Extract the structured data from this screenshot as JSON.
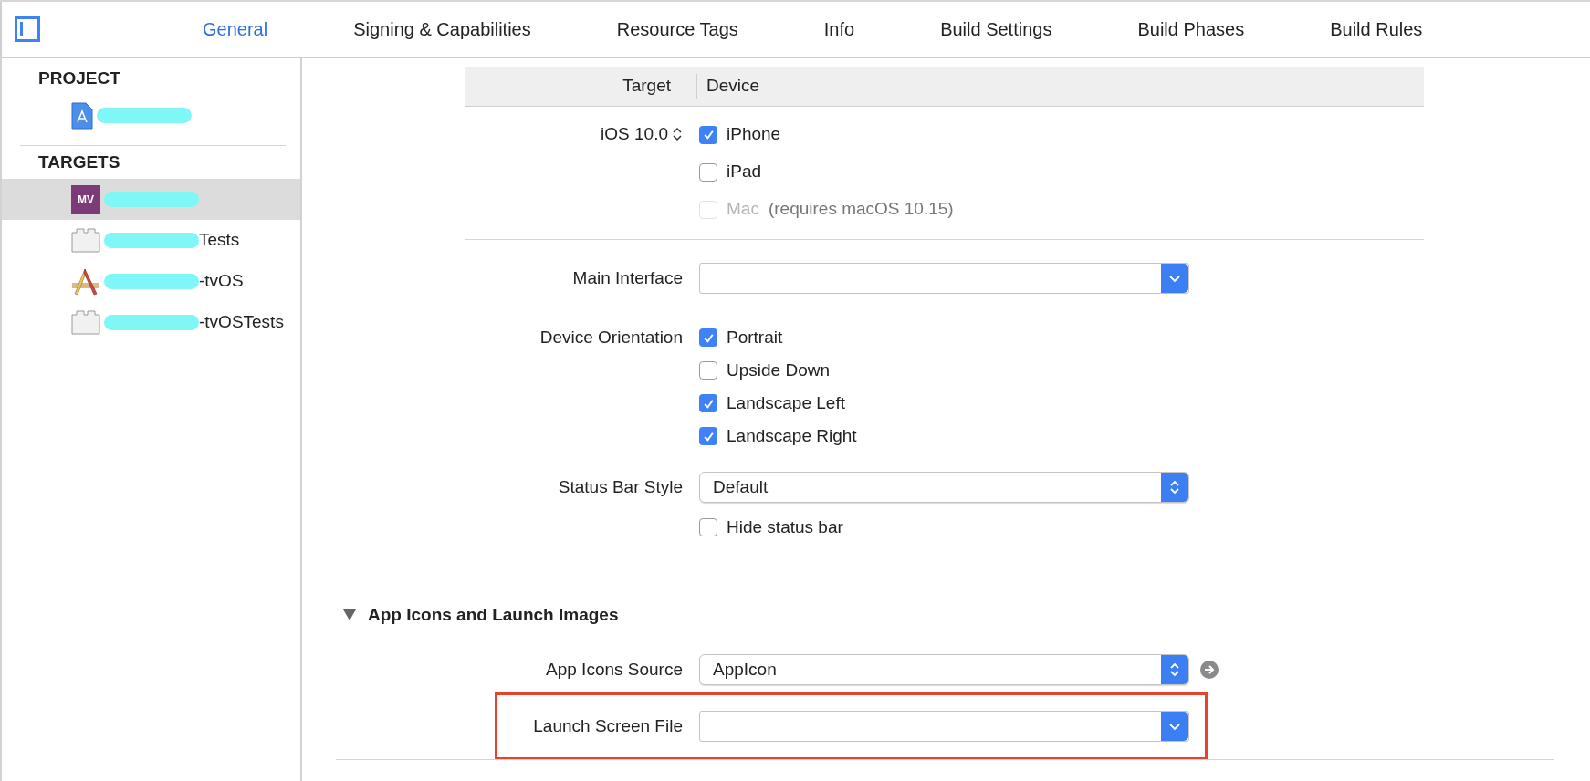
{
  "tabs": [
    {
      "label": "General",
      "selected": true
    },
    {
      "label": "Signing & Capabilities",
      "selected": false
    },
    {
      "label": "Resource Tags",
      "selected": false
    },
    {
      "label": "Info",
      "selected": false
    },
    {
      "label": "Build Settings",
      "selected": false
    },
    {
      "label": "Build Phases",
      "selected": false
    },
    {
      "label": "Build Rules",
      "selected": false
    }
  ],
  "sidebar": {
    "sections": [
      {
        "title": "PROJECT",
        "items": [
          {
            "kind": "project",
            "redacted": true,
            "selected": false
          }
        ]
      },
      {
        "title": "TARGETS",
        "items": [
          {
            "kind": "app",
            "badge": "MV",
            "redacted": true,
            "selected": true
          },
          {
            "kind": "test",
            "label": "Tests",
            "redacted": true,
            "selected": false
          },
          {
            "kind": "tvapp",
            "label": "-tvOS",
            "redacted": true,
            "selected": false
          },
          {
            "kind": "test",
            "label": "-tvOSTests",
            "redacted": true,
            "selected": false
          }
        ]
      }
    ]
  },
  "deployment": {
    "header": {
      "target": "Target",
      "device": "Device"
    },
    "target_version": "iOS 10.0",
    "devices": [
      {
        "label": "iPhone",
        "checked": true,
        "disabled": false
      },
      {
        "label": "iPad",
        "checked": false,
        "disabled": false
      },
      {
        "label": "Mac",
        "checked": false,
        "disabled": true,
        "note": "(requires macOS 10.15)"
      }
    ]
  },
  "main_interface": {
    "label": "Main Interface",
    "kind": "pulldown"
  },
  "orientation": {
    "label": "Device Orientation",
    "options": [
      {
        "label": "Portrait",
        "checked": true
      },
      {
        "label": "Upside Down",
        "checked": false
      },
      {
        "label": "Landscape Left",
        "checked": true
      },
      {
        "label": "Landscape Right",
        "checked": true
      }
    ]
  },
  "status_bar": {
    "label": "Status Bar Style",
    "kind": "popup",
    "value": "Default",
    "hide": {
      "label": "Hide status bar",
      "checked": false
    }
  },
  "app_icons": {
    "title": "App Icons and Launch Images",
    "expanded": true,
    "source": {
      "label": "App Icons Source",
      "kind": "popup",
      "value": "AppIcon"
    },
    "launch_screen": {
      "label": "Launch Screen File",
      "kind": "pulldown",
      "highlighted": true
    }
  }
}
